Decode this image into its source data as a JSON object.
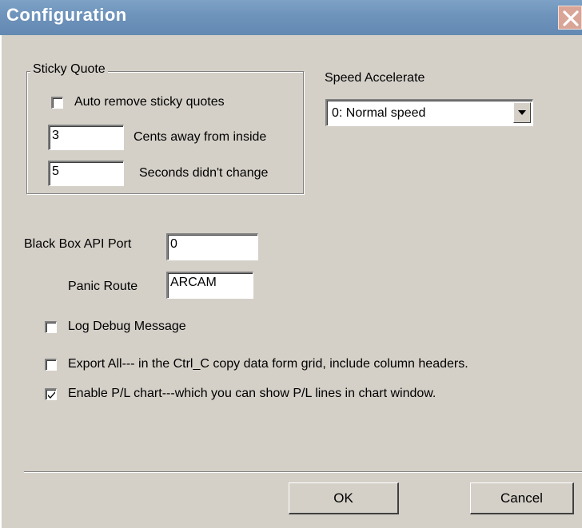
{
  "window": {
    "title": "Configuration",
    "close_label": "✕"
  },
  "sticky_quote": {
    "group_label": "Sticky Quote",
    "auto_remove": {
      "label": "Auto remove sticky quotes",
      "checked": false
    },
    "cents_away": {
      "value": "3",
      "label": "Cents away from inside"
    },
    "seconds": {
      "value": "5",
      "label": "Seconds didn't change"
    }
  },
  "speed": {
    "label": "Speed Accelerate",
    "selected": "0: Normal speed"
  },
  "black_box": {
    "label": "Black Box API Port",
    "value": "0"
  },
  "panic_route": {
    "label": "Panic Route",
    "value": "ARCAM"
  },
  "options": {
    "log_debug": {
      "label": "Log Debug Message",
      "checked": false
    },
    "export_all": {
      "label": "Export All--- in the Ctrl_C copy data form grid,  include column headers.",
      "checked": false
    },
    "enable_pl": {
      "label": "Enable P/L chart---which you can show P/L lines in chart window.",
      "checked": true
    }
  },
  "buttons": {
    "ok": "OK",
    "cancel": "Cancel"
  },
  "colors": {
    "title_bar": "#6e93bb",
    "dialog_bg": "#d4d0c8",
    "close_button": "#d9a597"
  }
}
